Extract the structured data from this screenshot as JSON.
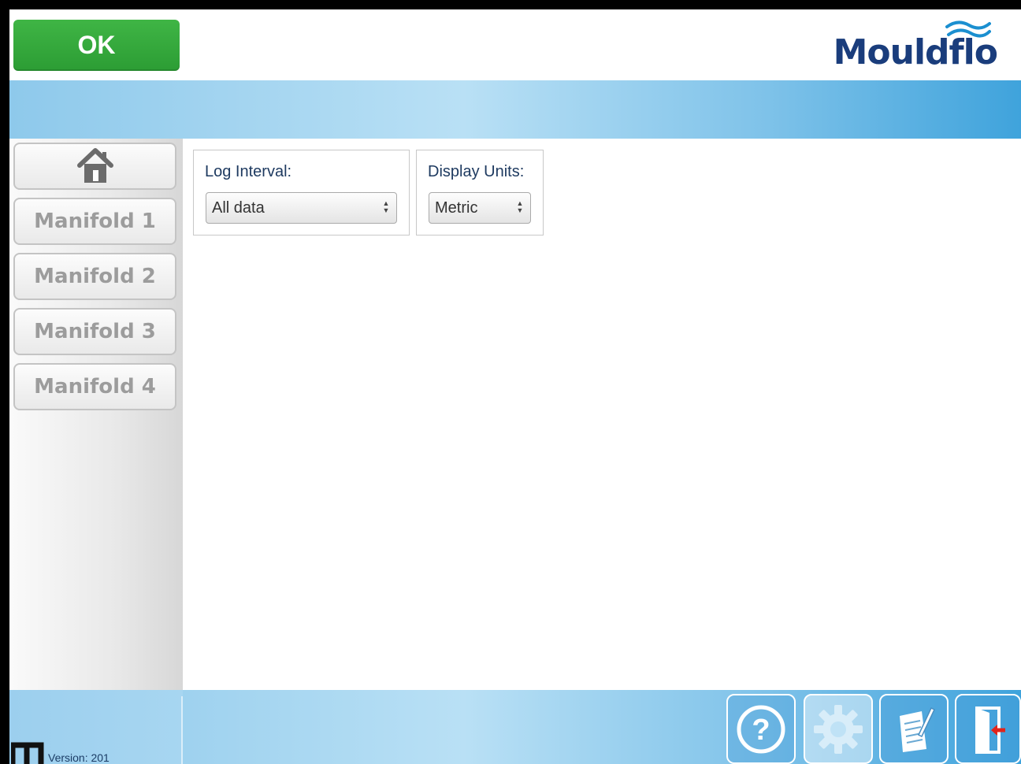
{
  "header": {
    "ok_label": "OK",
    "logo_text": "Mouldflo"
  },
  "sidebar": {
    "items": [
      {
        "label": "",
        "icon": "home-icon"
      },
      {
        "label": "Manifold 1"
      },
      {
        "label": "Manifold 2"
      },
      {
        "label": "Manifold 3"
      },
      {
        "label": "Manifold 4"
      }
    ]
  },
  "settings": {
    "log_interval": {
      "label": "Log Interval:",
      "value": "All data"
    },
    "display_units": {
      "label": "Display Units:",
      "value": "Metric"
    }
  },
  "footer": {
    "version": "Version: 201",
    "buttons": [
      {
        "icon": "help-icon"
      },
      {
        "icon": "gear-icon",
        "active": true
      },
      {
        "icon": "notes-icon"
      },
      {
        "icon": "exit-icon"
      }
    ]
  },
  "colors": {
    "ok_green": "#36a83d",
    "brand_blue": "#1a3d7c",
    "accent_blue": "#3fa3dc",
    "exit_red": "#e2231a"
  }
}
